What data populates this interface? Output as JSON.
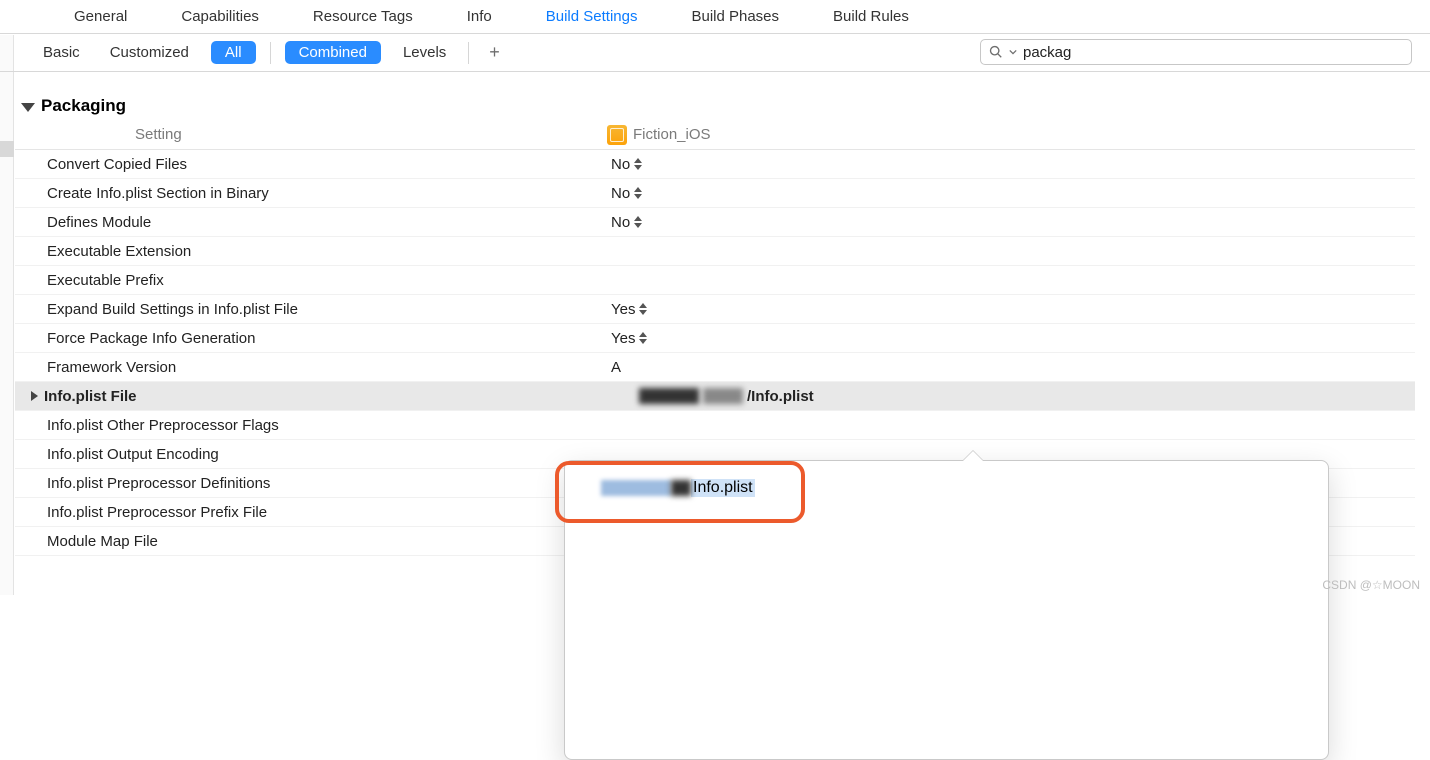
{
  "topTabs": {
    "general": "General",
    "capabilities": "Capabilities",
    "resourceTags": "Resource Tags",
    "info": "Info",
    "buildSettings": "Build Settings",
    "buildPhases": "Build Phases",
    "buildRules": "Build Rules"
  },
  "filterBar": {
    "basic": "Basic",
    "customized": "Customized",
    "all": "All",
    "combined": "Combined",
    "levels": "Levels",
    "plus": "+"
  },
  "search": {
    "value": "packag"
  },
  "section": {
    "title": "Packaging"
  },
  "columns": {
    "setting": "Setting",
    "target": "Fiction_iOS"
  },
  "rows": {
    "r0": {
      "label": "Convert Copied Files",
      "val": "No"
    },
    "r1": {
      "label": "Create Info.plist Section in Binary",
      "val": "No"
    },
    "r2": {
      "label": "Defines Module",
      "val": "No"
    },
    "r3": {
      "label": "Executable Extension",
      "val": ""
    },
    "r4": {
      "label": "Executable Prefix",
      "val": ""
    },
    "r5": {
      "label": "Expand Build Settings in Info.plist File",
      "val": "Yes"
    },
    "r6": {
      "label": "Force Package Info Generation",
      "val": "Yes"
    },
    "r7": {
      "label": "Framework Version",
      "val": "A"
    },
    "r8": {
      "label": "Info.plist File",
      "valSuffix": "/Info.plist"
    },
    "r9": {
      "label": "Info.plist Other Preprocessor Flags",
      "val": ""
    },
    "r10": {
      "label": "Info.plist Output Encoding",
      "val": ""
    },
    "r11": {
      "label": "Info.plist Preprocessor Definitions",
      "val": ""
    },
    "r12": {
      "label": "Info.plist Preprocessor Prefix File",
      "val": ""
    },
    "r13": {
      "label": "Module Map File",
      "val": ""
    }
  },
  "popover": {
    "valueSuffix": "Info.plist"
  },
  "watermark": "CSDN @☆MOON"
}
